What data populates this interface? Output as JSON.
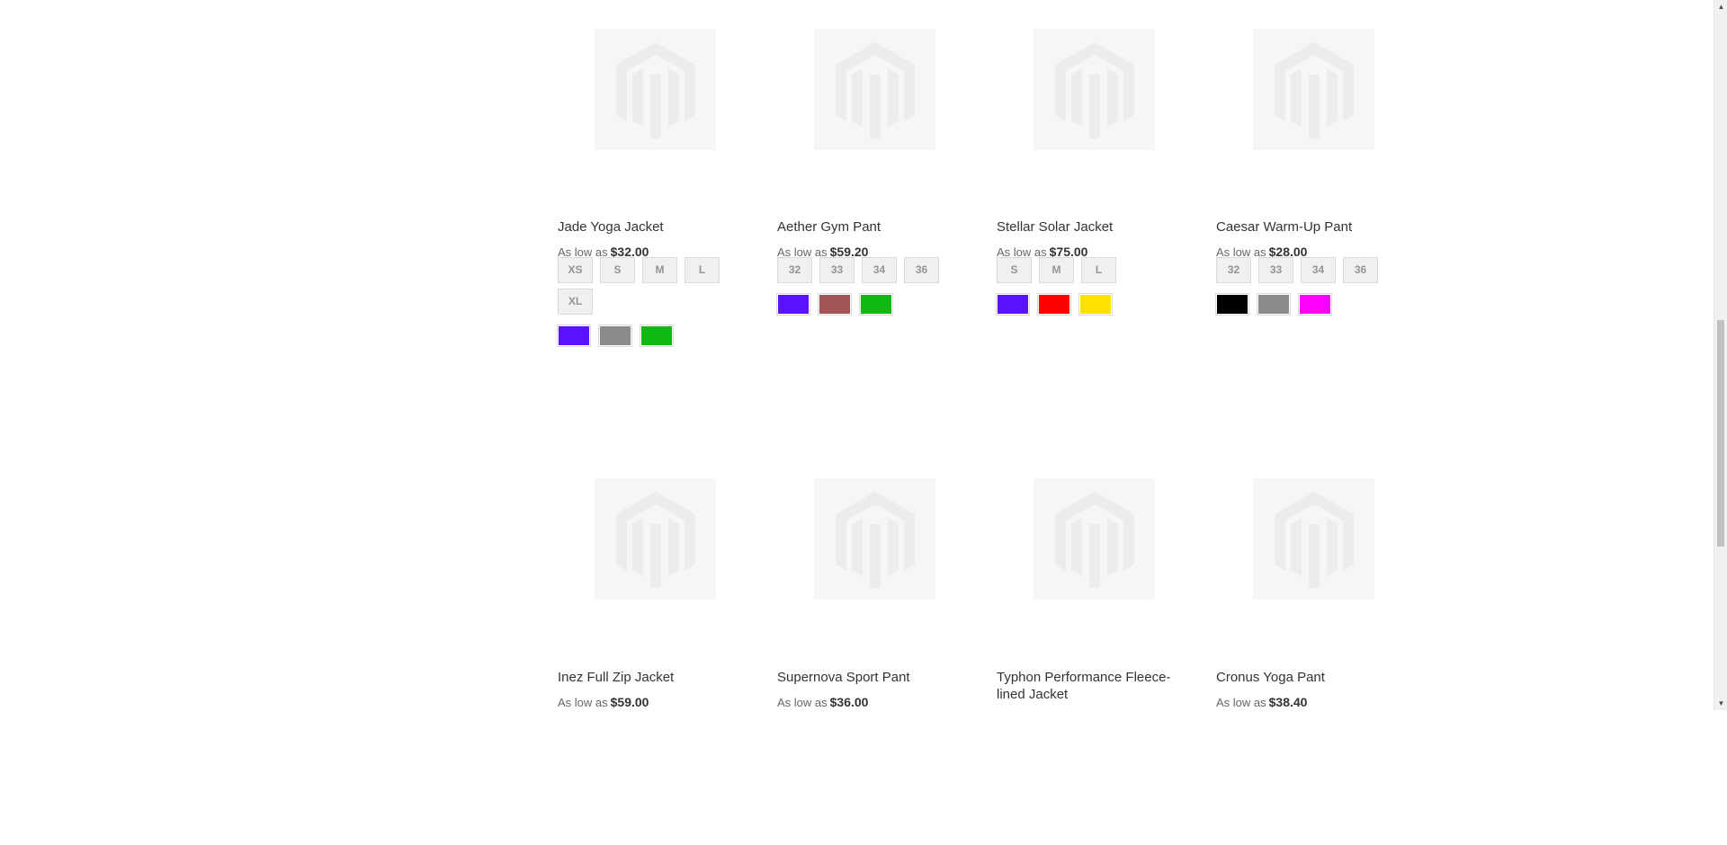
{
  "products": [
    {
      "name": "Jade Yoga Jacket",
      "price_prefix": "As low as",
      "price": "$32.00",
      "sizes": [
        "XS",
        "S",
        "M",
        "L",
        "XL"
      ],
      "colors": [
        "#5a12ff",
        "#8c8c8c",
        "#12b812"
      ]
    },
    {
      "name": "Aether Gym Pant",
      "price_prefix": "As low as",
      "price": "$59.20",
      "sizes": [
        "32",
        "33",
        "34",
        "36"
      ],
      "colors": [
        "#5a12ff",
        "#a35555",
        "#12b812"
      ]
    },
    {
      "name": "Stellar Solar Jacket",
      "price_prefix": "As low as",
      "price": "$75.00",
      "sizes": [
        "S",
        "M",
        "L"
      ],
      "colors": [
        "#5a12ff",
        "#ff0000",
        "#ffe100"
      ]
    },
    {
      "name": "Caesar Warm-Up Pant",
      "price_prefix": "As low as",
      "price": "$28.00",
      "sizes": [
        "32",
        "33",
        "34",
        "36"
      ],
      "colors": [
        "#000000",
        "#8c8c8c",
        "#ff00ff"
      ]
    },
    {
      "name": "Inez Full Zip Jacket",
      "price_prefix": "As low as",
      "price": "$59.00",
      "sizes": [],
      "colors": []
    },
    {
      "name": "Supernova Sport Pant",
      "price_prefix": "As low as",
      "price": "$36.00",
      "sizes": [],
      "colors": []
    },
    {
      "name": "Typhon Performance Fleece-lined Jacket",
      "price_prefix": "",
      "price": "",
      "sizes": [],
      "colors": []
    },
    {
      "name": "Cronus Yoga Pant",
      "price_prefix": "As low as",
      "price": "$38.40",
      "sizes": [],
      "colors": []
    }
  ],
  "placeholder_icon": "magento-logo-icon",
  "scrollbar": {
    "up_icon": "▲",
    "down_icon": "▼"
  }
}
